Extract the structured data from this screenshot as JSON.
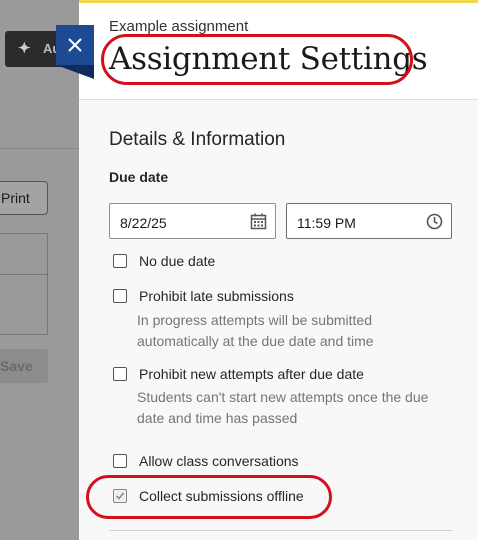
{
  "background": {
    "ai_button_label": "Au",
    "print_label": "Print",
    "save_label": "Save"
  },
  "panel": {
    "subtitle": "Example assignment",
    "title": "Assignment Settings",
    "section_heading": "Details & Information",
    "due_date_label": "Due date",
    "date_value": "8/22/25",
    "time_value": "11:59 PM",
    "options": {
      "no_due_date": "No due date",
      "prohibit_late": "Prohibit late submissions",
      "prohibit_late_help": "In progress attempts will be submitted automatically at the due date and time",
      "prohibit_new": "Prohibit new attempts after due date",
      "prohibit_new_help": "Students can't start new attempts once the due date and time has passed",
      "class_conversations": "Allow class conversations",
      "collect_offline": "Collect submissions offline"
    },
    "collect_offline_checked": true
  },
  "colors": {
    "accent": "#1d4a92",
    "highlight": "#d4101c",
    "header_bar": "#f2d848"
  }
}
